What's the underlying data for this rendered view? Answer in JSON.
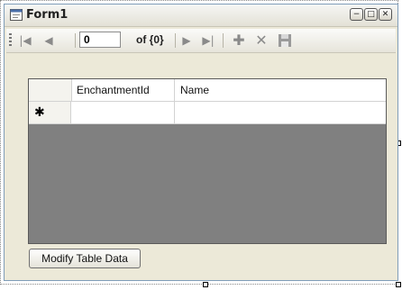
{
  "window": {
    "title": "Form1",
    "controls": {
      "minimize": "−",
      "maximize": "□",
      "close": "✕"
    }
  },
  "navigator": {
    "position_value": "0",
    "count_label": "of {0}",
    "icons": [
      "move-first-icon",
      "move-previous-icon",
      "move-next-icon",
      "move-last-icon",
      "add-new-icon",
      "delete-icon",
      "save-icon"
    ]
  },
  "grid": {
    "columns": [
      "EnchantmentId",
      "Name"
    ],
    "new_row_marker": "✱",
    "rows": []
  },
  "buttons": {
    "modify_label": "Modify Table Data"
  }
}
